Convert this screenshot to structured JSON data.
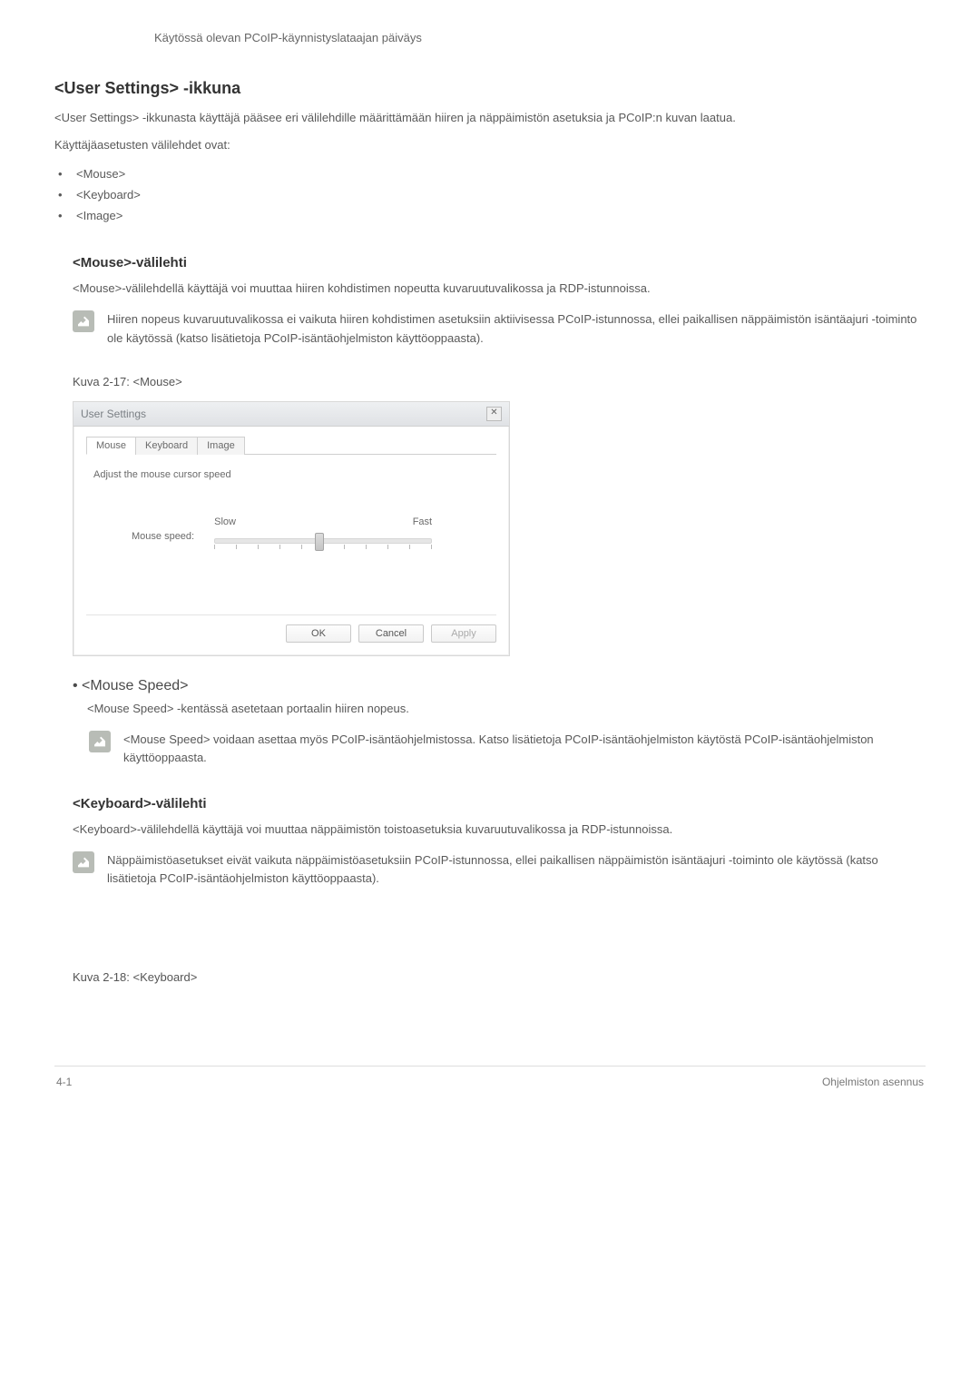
{
  "top_note": "Käytössä olevan PCoIP-käynnistyslataajan päiväys",
  "h_user_settings": "<User Settings> -ikkuna",
  "p_user_settings_1": "<User Settings> -ikkunasta käyttäjä pääsee eri välilehdille määrittämään hiiren ja näppäimistön asetuksia ja PCoIP:n kuvan laatua.",
  "p_user_settings_2": "Käyttäjäasetusten välilehdet ovat:",
  "tabs_list": [
    "<Mouse>",
    "<Keyboard>",
    "<Image>"
  ],
  "h_mouse": "<Mouse>-välilehti",
  "p_mouse_1": "<Mouse>-välilehdellä käyttäjä voi muuttaa hiiren kohdistimen nopeutta kuvaruutuvalikossa ja RDP-istunnoissa.",
  "note_mouse": "Hiiren nopeus kuvaruutuvalikossa ei vaikuta hiiren kohdistimen asetuksiin aktiivisessa PCoIP-istunnossa, ellei paikallisen näppäimistön isäntäajuri -toiminto ole käytössä (katso lisätietoja PCoIP-isäntäohjelmiston käyttöoppaasta).",
  "fig_mouse_caption": "Kuva 2-17: <Mouse>",
  "dialog": {
    "title": "User Settings",
    "tabs": [
      "Mouse",
      "Keyboard",
      "Image"
    ],
    "instruction": "Adjust the mouse cursor speed",
    "slider_label": "Mouse speed:",
    "slow": "Slow",
    "fast": "Fast",
    "ok": "OK",
    "cancel": "Cancel",
    "apply": "Apply"
  },
  "bullet_mouse_speed": "<Mouse Speed>",
  "bullet_mouse_speed_desc": "<Mouse Speed> -kentässä asetetaan portaalin hiiren nopeus.",
  "note_mouse_speed": "<Mouse Speed> voidaan asettaa myös PCoIP-isäntäohjelmistossa. Katso lisätietoja PCoIP-isäntäohjelmiston käytöstä PCoIP-isäntäohjelmiston käyttöoppaasta.",
  "h_keyboard": "<Keyboard>-välilehti",
  "p_keyboard_1": "<Keyboard>-välilehdellä käyttäjä voi muuttaa näppäimistön toistoasetuksia kuvaruutuvalikossa ja RDP-istunnoissa.",
  "note_keyboard": "Näppäimistöasetukset eivät vaikuta näppäimistöasetuksiin PCoIP-istunnossa, ellei paikallisen näppäimistön isäntäajuri -toiminto ole käytössä (katso lisätietoja PCoIP-isäntäohjelmiston käyttöoppaasta).",
  "fig_keyboard_caption": "Kuva 2-18: <Keyboard>",
  "footer_left": "4-1",
  "footer_right": "Ohjelmiston asennus"
}
